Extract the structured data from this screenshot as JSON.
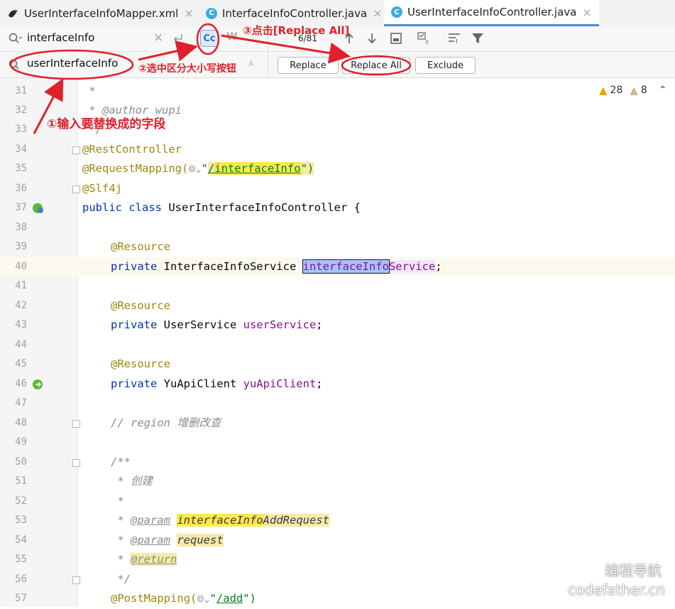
{
  "tabs": [
    {
      "label": "UserInterfaceInfoMapper.xml",
      "close": "×"
    },
    {
      "label": "InterfaceInfoController.java",
      "close": "×"
    },
    {
      "label": "UserInterfaceInfoController.java",
      "close": "×"
    }
  ],
  "find": {
    "value": "interfaceInfo",
    "count": "6/81",
    "case_label": "Cc",
    "words_label": "W"
  },
  "replace": {
    "value": "userInterfaceInfo",
    "replace_label": "Replace",
    "replace_all_label": "Replace All",
    "exclude_label": "Exclude"
  },
  "inspections": {
    "warnings": "28",
    "weak": "8"
  },
  "annotations": {
    "step1": "①输入要替换成的字段",
    "step2": "②选中区分大小写按钮",
    "step3": "③点击[Replace All]"
  },
  "watermark": {
    "line1": "编程导航",
    "line2": "codefather.cn"
  },
  "lines": [
    {
      "n": "31",
      "t": " *"
    },
    {
      "n": "32",
      "t": " * @author wupi"
    },
    {
      "n": "33",
      "t": " */"
    },
    {
      "n": "34",
      "t": "@RestController"
    },
    {
      "n": "35",
      "a": "@RequestMapping(",
      "b": "\"",
      "c": "/",
      "d": "interfaceInfo",
      "e": "\")"
    },
    {
      "n": "36",
      "t": "@Slf4j"
    },
    {
      "n": "37",
      "k": "public class ",
      "t": "UserInterfaceInfoController {"
    },
    {
      "n": "38",
      "t": ""
    },
    {
      "n": "39",
      "t": "@Resource"
    },
    {
      "n": "40",
      "k": "private ",
      "a": "InterfaceInfoService ",
      "s": "interfaceInfo",
      "f": "Service",
      ";": ";"
    },
    {
      "n": "41",
      "t": ""
    },
    {
      "n": "42",
      "t": "@Resource"
    },
    {
      "n": "43",
      "k": "private ",
      "a": "UserService ",
      "f": "userService",
      ";": ";"
    },
    {
      "n": "44",
      "t": ""
    },
    {
      "n": "45",
      "t": "@Resource"
    },
    {
      "n": "46",
      "k": "private ",
      "a": "YuApiClient ",
      "f": "yuApiClient",
      ";": ";"
    },
    {
      "n": "47",
      "t": ""
    },
    {
      "n": "48",
      "t": "// region 增删改查"
    },
    {
      "n": "49",
      "t": ""
    },
    {
      "n": "50",
      "t": "/**"
    },
    {
      "n": "51",
      "t": " * 创建"
    },
    {
      "n": "52",
      "t": " *"
    },
    {
      "n": "53",
      "p": "@param",
      "h": "interfaceInfo",
      "r": "AddRequest"
    },
    {
      "n": "54",
      "p": "@param",
      "r": "request"
    },
    {
      "n": "55",
      "p": "@return"
    },
    {
      "n": "56",
      "t": " */"
    },
    {
      "n": "57",
      "a": "@PostMapping(",
      "b": "\"",
      "c": "/add",
      "e": "\")"
    }
  ]
}
